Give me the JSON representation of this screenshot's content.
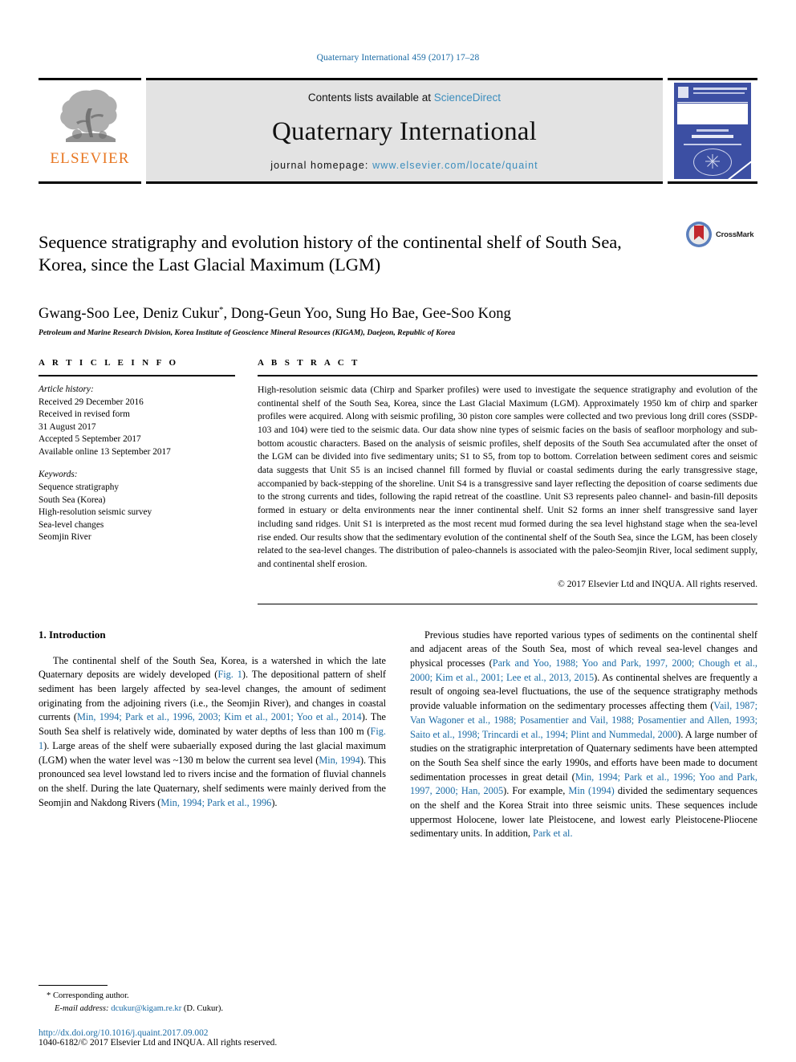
{
  "running_head": "Quaternary International 459 (2017) 17–28",
  "masthead": {
    "publisher_logo_text": "ELSEVIER",
    "contents_prefix": "Contents lists available at",
    "contents_link": "ScienceDirect",
    "journal_name": "Quaternary International",
    "homepage_prefix": "journal homepage:",
    "homepage_url": "www.elsevier.com/locate/quaint",
    "cover_alt": "journal-cover-thumbnail"
  },
  "article": {
    "title": "Sequence stratigraphy and evolution history of the continental shelf of South Sea, Korea, since the Last Glacial Maximum (LGM)",
    "crossmark_label": "CrossMark",
    "authors": "Gwang-Soo Lee, Deniz Cukur",
    "authors_rest": ", Dong-Geun Yoo, Sung Ho Bae, Gee-Soo Kong",
    "author_marker": "*",
    "affiliation": "Petroleum and Marine Research Division, Korea Institute of Geoscience Mineral Resources (KIGAM), Daejeon, Republic of Korea"
  },
  "article_info": {
    "heading": "A R T I C L E   I N F O",
    "history_label": "Article history:",
    "history": [
      "Received 29 December 2016",
      "Received in revised form",
      "31 August 2017",
      "Accepted 5 September 2017",
      "Available online 13 September 2017"
    ],
    "keywords_label": "Keywords:",
    "keywords": [
      "Sequence stratigraphy",
      "South Sea (Korea)",
      "High-resolution seismic survey",
      "Sea-level changes",
      "Seomjin River"
    ]
  },
  "abstract": {
    "heading": "A B S T R A C T",
    "text": "High-resolution seismic data (Chirp and Sparker profiles) were used to investigate the sequence stratigraphy and evolution of the continental shelf of the South Sea, Korea, since the Last Glacial Maximum (LGM). Approximately 1950 km of chirp and sparker profiles were acquired. Along with seismic profiling, 30 piston core samples were collected and two previous long drill cores (SSDP-103 and 104) were tied to the seismic data. Our data show nine types of seismic facies on the basis of seafloor morphology and sub-bottom acoustic characters. Based on the analysis of seismic profiles, shelf deposits of the South Sea accumulated after the onset of the LGM can be divided into five sedimentary units; S1 to S5, from top to bottom. Correlation between sediment cores and seismic data suggests that Unit S5 is an incised channel fill formed by fluvial or coastal sediments during the early transgressive stage, accompanied by back-stepping of the shoreline. Unit S4 is a transgressive sand layer reflecting the deposition of coarse sediments due to the strong currents and tides, following the rapid retreat of the coastline. Unit S3 represents paleo channel- and basin-fill deposits formed in estuary or delta environments near the inner continental shelf. Unit S2 forms an inner shelf transgressive sand layer including sand ridges. Unit S1 is interpreted as the most recent mud formed during the sea level highstand stage when the sea-level rise ended. Our results show that the sedimentary evolution of the continental shelf of the South Sea, since the LGM, has been closely related to the sea-level changes. The distribution of paleo-channels is associated with the paleo-Seomjin River, local sediment supply, and continental shelf erosion.",
    "copyright": "© 2017 Elsevier Ltd and INQUA. All rights reserved."
  },
  "intro": {
    "heading": "1.  Introduction",
    "left_p1_a": "The continental shelf of the South Sea, Korea, is a watershed in which the late Quaternary deposits are widely developed (",
    "left_p1_fig1": "Fig. 1",
    "left_p1_b": "). The depositional pattern of shelf sediment has been largely affected by sea-level changes, the amount of sediment originating from the adjoining rivers (i.e., the Seomjin River), and changes in coastal currents (",
    "left_p1_refs1": "Min, 1994; Park et al., 1996, 2003; Kim et al., 2001; Yoo et al., 2014",
    "left_p1_c": "). The South Sea shelf is relatively wide, dominated by water depths of less than 100 m (",
    "left_p1_fig1b": "Fig. 1",
    "left_p1_d": "). Large areas of the shelf were subaerially exposed during the last glacial maximum (LGM) when the water level was ~130 m below the current sea level (",
    "left_p1_refs2": "Min, 1994",
    "left_p1_e": "). This pronounced sea level lowstand led to rivers incise and the formation of fluvial channels on the shelf. During the late Quaternary, shelf sediments were mainly derived from the Seomjin and Nakdong Rivers (",
    "left_p1_refs3": "Min, 1994; Park et al., 1996",
    "left_p1_f": ").",
    "right_p1_a": "Previous studies have reported various types of sediments on the continental shelf and adjacent areas of the South Sea, most of which reveal sea-level changes and physical processes (",
    "right_p1_refs1": "Park and Yoo, 1988; Yoo and Park, 1997, 2000; Chough et al., 2000; Kim et al., 2001; Lee et al., 2013, 2015",
    "right_p1_b": "). As continental shelves are frequently a result of ongoing sea-level fluctuations, the use of the sequence stratigraphy methods provide valuable information on the sedimentary processes affecting them (",
    "right_p1_refs2": "Vail, 1987; Van Wagoner et al., 1988; Posamentier and Vail, 1988; Posamentier and Allen, 1993; Saito et al., 1998; Trincardi et al., 1994; Plint and Nummedal, 2000",
    "right_p1_c": "). A large number of studies on the stratigraphic interpretation of Quaternary sediments have been attempted on the South Sea shelf since the early 1990s, and efforts have been made to document sedimentation processes in great detail (",
    "right_p1_refs3": "Min, 1994; Park et al., 1996; Yoo and Park, 1997, 2000; Han, 2005",
    "right_p1_d": "). For example, ",
    "right_p1_refs4": "Min (1994)",
    "right_p1_e": " divided the sedimentary sequences on the shelf and the Korea Strait into three seismic units. These sequences include uppermost Holocene, lower late Pleistocene, and lowest early Pleistocene-Pliocene sedimentary units. In addition, ",
    "right_p1_refs5": "Park et al."
  },
  "footer": {
    "corresponding_marker": "*",
    "corresponding_label": "Corresponding author.",
    "email_label": "E-mail address:",
    "email": "dcukur@kigam.re.kr",
    "email_suffix": "(D. Cukur).",
    "doi": "http://dx.doi.org/10.1016/j.quaint.2017.09.002",
    "issn_line": "1040-6182/© 2017 Elsevier Ltd and INQUA. All rights reserved."
  },
  "colors": {
    "link": "#1a6ba5",
    "elsevier_orange": "#e87722",
    "band_grey": "#e3e3e3",
    "cover_blue": "#3c4fa3"
  }
}
